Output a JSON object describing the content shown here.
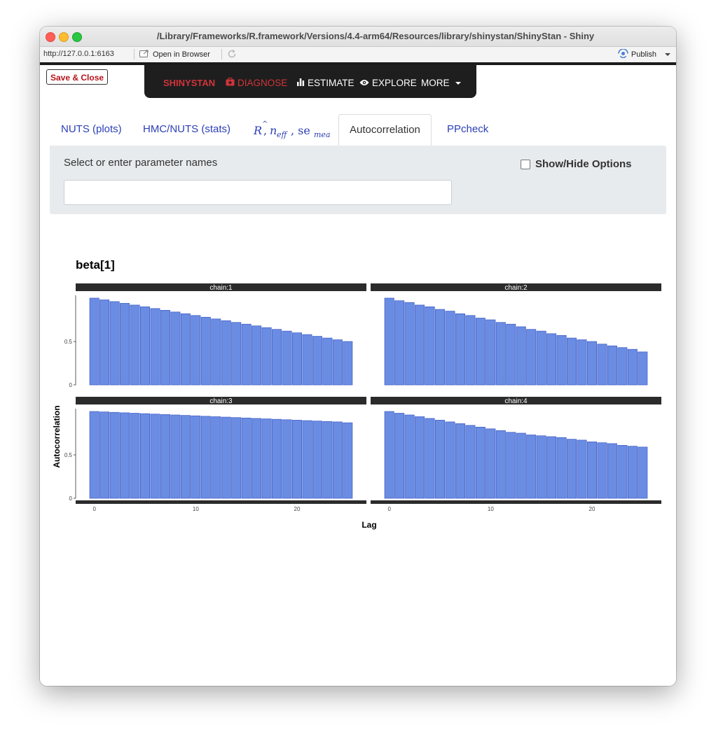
{
  "window": {
    "title": "/Library/Frameworks/R.framework/Versions/4.4-arm64/Resources/library/shinystan/ShinyStan - Shiny"
  },
  "toolbar": {
    "url": "http://127.0.0.1:6163",
    "open_in_browser": "Open in Browser",
    "publish": "Publish"
  },
  "app": {
    "save_close": "Save & Close",
    "nav": {
      "brand": "SHINYSTAN",
      "diagnose": "DIAGNOSE",
      "estimate": "ESTIMATE",
      "explore": "EXPLORE",
      "more": "MORE"
    },
    "tabs": {
      "nuts_plots": "NUTS (plots)",
      "hmc_stats": "HMC/NUTS (stats)",
      "autocorrelation": "Autocorrelation",
      "ppcheck": "PPcheck"
    },
    "panel": {
      "label": "Select or enter parameter names",
      "input_value": "",
      "show_hide": "Show/Hide Options"
    }
  },
  "colors": {
    "nav_bg": "#1e1e1e",
    "brand_red": "#d1343a",
    "tab_link": "#2c3fb5",
    "bar_fill": "#6a8ce3",
    "bar_stroke": "#3e5ac4",
    "strip_bg": "#2b2b2b"
  },
  "chart_data": {
    "type": "bar",
    "title": "beta[1]",
    "xlabel": "Lag",
    "ylabel": "Autocorrelation",
    "ylim": [
      0,
      1
    ],
    "xticks": [
      0,
      10,
      20
    ],
    "yticks": [
      0,
      0.5
    ],
    "x": [
      0,
      1,
      2,
      3,
      4,
      5,
      6,
      7,
      8,
      9,
      10,
      11,
      12,
      13,
      14,
      15,
      16,
      17,
      18,
      19,
      20,
      21,
      22,
      23,
      24,
      25
    ],
    "panels": [
      {
        "strip": "chain:1",
        "values": [
          1.0,
          0.98,
          0.96,
          0.94,
          0.92,
          0.9,
          0.88,
          0.86,
          0.84,
          0.82,
          0.8,
          0.78,
          0.76,
          0.74,
          0.72,
          0.7,
          0.68,
          0.66,
          0.64,
          0.62,
          0.6,
          0.58,
          0.56,
          0.54,
          0.52,
          0.5
        ]
      },
      {
        "strip": "chain:2",
        "values": [
          1.0,
          0.97,
          0.95,
          0.92,
          0.9,
          0.87,
          0.85,
          0.82,
          0.8,
          0.77,
          0.75,
          0.72,
          0.7,
          0.67,
          0.64,
          0.62,
          0.59,
          0.57,
          0.54,
          0.52,
          0.5,
          0.47,
          0.45,
          0.43,
          0.41,
          0.38
        ]
      },
      {
        "strip": "chain:3",
        "values": [
          1.0,
          0.995,
          0.99,
          0.985,
          0.98,
          0.975,
          0.97,
          0.965,
          0.96,
          0.955,
          0.95,
          0.945,
          0.94,
          0.935,
          0.93,
          0.925,
          0.92,
          0.915,
          0.91,
          0.905,
          0.9,
          0.895,
          0.89,
          0.885,
          0.88,
          0.87
        ]
      },
      {
        "strip": "chain:4",
        "values": [
          1.0,
          0.98,
          0.96,
          0.94,
          0.92,
          0.9,
          0.88,
          0.86,
          0.84,
          0.82,
          0.8,
          0.78,
          0.76,
          0.75,
          0.73,
          0.72,
          0.71,
          0.7,
          0.68,
          0.67,
          0.65,
          0.64,
          0.63,
          0.61,
          0.6,
          0.59
        ]
      }
    ]
  }
}
